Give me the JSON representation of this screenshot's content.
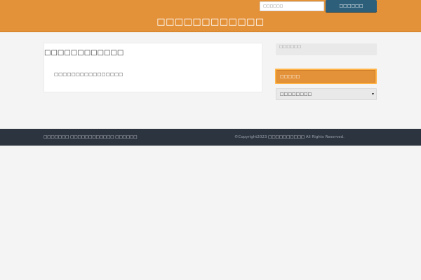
{
  "header": {
    "site_title": "□□□□□□□□□□□□",
    "search_placeholder": "□□□□□□",
    "search_button_label": "□□□□□□"
  },
  "main": {
    "title": "□□□□□□□□□□□□",
    "body": "□□□□□□□□□□□□□□□□"
  },
  "sidebar": {
    "search_placeholder": "□□□□□□",
    "widget_title": "□□□□□",
    "select_value": "□□□□□□□□"
  },
  "footer": {
    "links": [
      "□□□□□□□",
      "□□□□□□□□□□□□",
      "□□□□□□"
    ],
    "copyright_prefix": "©Copyright2023",
    "copyright_site": "□□□□□□□□□□",
    "copyright_suffix": "All Rights Reserved."
  },
  "colors": {
    "header_bg": "#e4923a",
    "search_button_bg": "#2e5f7a",
    "footer_bg": "#2c3440"
  }
}
